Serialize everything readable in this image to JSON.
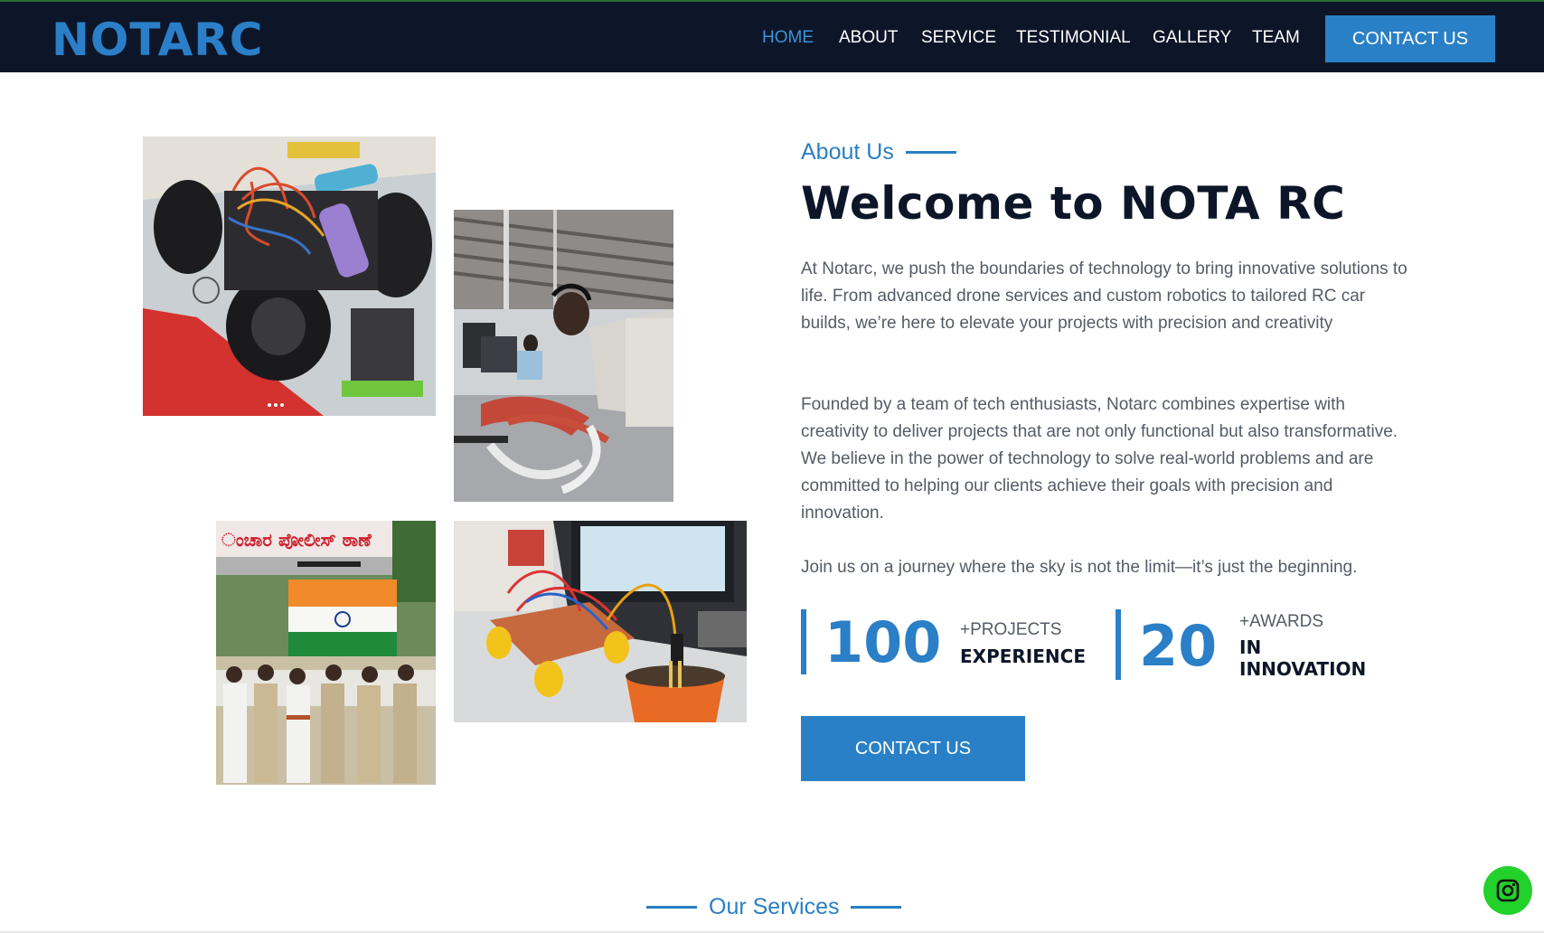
{
  "brand": {
    "logo": "NOTARC"
  },
  "nav": {
    "items": [
      {
        "label": "HOME",
        "active": true
      },
      {
        "label": "ABOUT",
        "active": false
      },
      {
        "label": "SERVICE",
        "active": false
      },
      {
        "label": "TESTIMONIAL",
        "active": false
      },
      {
        "label": "GALLERY",
        "active": false
      },
      {
        "label": "TEAM",
        "active": false
      }
    ],
    "cta_label": "CONTACT US"
  },
  "about": {
    "eyebrow": "About Us",
    "headline": "Welcome to NOTA RC",
    "paragraphs": [
      "At Notarc, we push the boundaries of technology to bring innovative solutions to life. From advanced drone services and custom robotics to tailored RC car builds, we’re here to elevate your projects with precision and creativity",
      "Founded by a team of tech enthusiasts, Notarc combines expertise with creativity to deliver projects that are not only functional but also transformative. We believe in the power of technology to solve real-world problems and are committed to helping our clients achieve their goals with precision and innovation.",
      "Join us on a journey where the sky is not the limit—it’s just the beginning."
    ],
    "stats": [
      {
        "number": "100",
        "small": "+PROJECTS",
        "big": "EXPERIENCE"
      },
      {
        "number": "20",
        "small": "+AWARDS",
        "big_line1": "IN",
        "big_line2": "INNOVATION"
      }
    ],
    "cta_label": "CONTACT US"
  },
  "services": {
    "heading": "Our Services"
  },
  "floating": {
    "icon": "instagram-icon"
  },
  "colors": {
    "navbar_bg": "#0d1628",
    "accent": "#2a80c6",
    "text_dark": "#0d1628",
    "text_body": "#555b66",
    "float_button": "#22d12a"
  }
}
